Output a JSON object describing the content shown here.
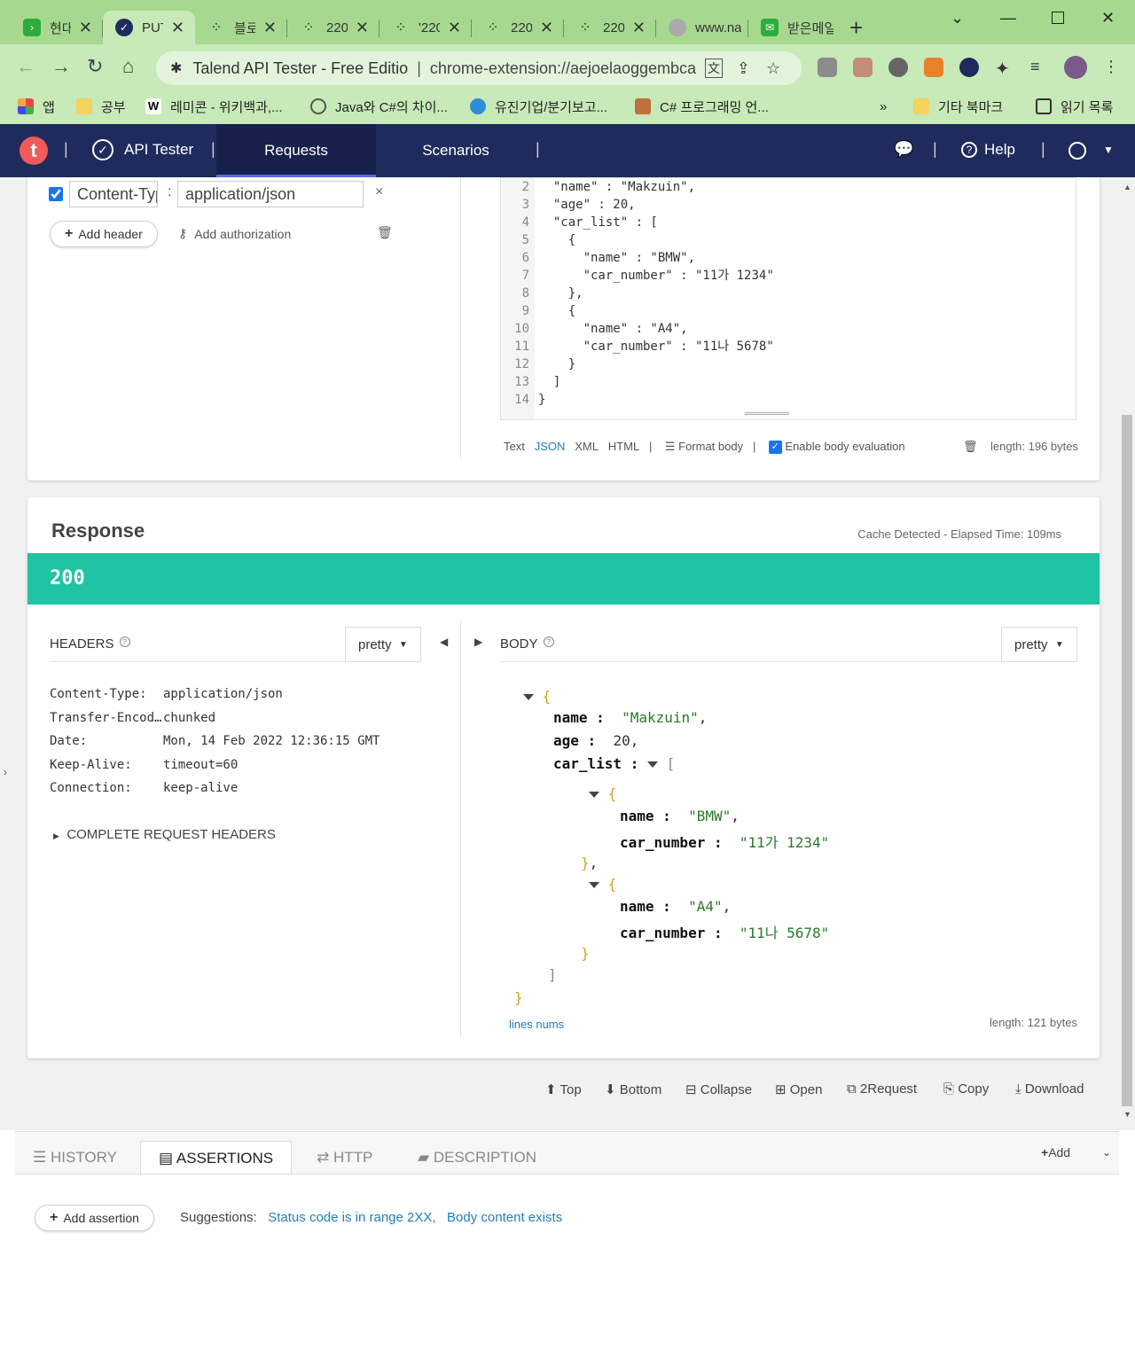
{
  "browser": {
    "tabs": [
      {
        "label": "현대",
        "color": "#2ead3b"
      },
      {
        "label": "PUT",
        "color": "#1f2b5c"
      },
      {
        "label": "블로",
        "color": "#333333"
      },
      {
        "label": "220",
        "color": "#333333"
      },
      {
        "label": "'220",
        "color": "#333333"
      },
      {
        "label": "220",
        "color": "#333333"
      },
      {
        "label": "220",
        "color": "#333333"
      },
      {
        "label": "www.na",
        "color": "#aaaaaa"
      },
      {
        "label": "받은메일",
        "color": "#2ead3b"
      }
    ],
    "omnibox": {
      "title": "Talend API Tester - Free Editio",
      "url": "chrome-extension://aejoelaoggembcahagimdiliamlcdmfm"
    },
    "bookmarks": [
      {
        "label": "앱"
      },
      {
        "label": "공부"
      },
      {
        "label": "레미콘 - 위키백과,..."
      },
      {
        "label": "Java와 C#의 차이..."
      },
      {
        "label": "유진기업/분기보고..."
      },
      {
        "label": "C# 프로그래밍 언..."
      }
    ],
    "bookmarks_more": "»",
    "other_bookmarks": "기타 북마크",
    "reading_list": "읽기 목록"
  },
  "app": {
    "logo": "t",
    "name": "API Tester",
    "nav": {
      "requests": "Requests",
      "scenarios": "Scenarios",
      "help": "Help"
    }
  },
  "request": {
    "header_name": "Content-Type",
    "header_value": "application/json",
    "remove": "×",
    "add_header": "Add header",
    "add_authorization": "Add authorization",
    "body_lines": [
      {
        "n": "2",
        "text": "  \"name\" : \"Makzuin\","
      },
      {
        "n": "3",
        "text": "  \"age\" : 20,"
      },
      {
        "n": "4",
        "text": "  \"car_list\" : ["
      },
      {
        "n": "5",
        "text": "    {"
      },
      {
        "n": "6",
        "text": "      \"name\" : \"BMW\","
      },
      {
        "n": "7",
        "text": "      \"car_number\" : \"11가 1234\""
      },
      {
        "n": "8",
        "text": "    },"
      },
      {
        "n": "9",
        "text": "    {"
      },
      {
        "n": "10",
        "text": "      \"name\" : \"A4\","
      },
      {
        "n": "11",
        "text": "      \"car_number\" : \"11나 5678\""
      },
      {
        "n": "12",
        "text": "    }"
      },
      {
        "n": "13",
        "text": "  ]"
      },
      {
        "n": "14",
        "text": "}"
      }
    ],
    "formats": {
      "text": "Text",
      "json": "JSON",
      "xml": "XML",
      "html": "HTML"
    },
    "format_body": "Format body",
    "enable_eval": "Enable body evaluation",
    "length": "length: 196 bytes"
  },
  "response": {
    "title": "Response",
    "cache": "Cache Detected - Elapsed Time: 109ms",
    "status": "200",
    "headers_label": "HEADERS",
    "body_label": "BODY",
    "pretty": "pretty",
    "headers": [
      {
        "k": "Content-Type:",
        "v": "application/json"
      },
      {
        "k": "Transfer-Encoding:",
        "v": "chunked"
      },
      {
        "k": "Date:",
        "v": "Mon, 14 Feb 2022 12:36:15 GMT"
      },
      {
        "k": "Keep-Alive:",
        "v": "timeout=60"
      },
      {
        "k": "Connection:",
        "v": "keep-alive"
      }
    ],
    "complete_headers": "COMPLETE REQUEST HEADERS",
    "body": {
      "name_key": "name :",
      "name_val": "\"Makzuin\"",
      "age_key": "age :",
      "age_val": "20",
      "carlist_key": "car_list :",
      "car1_name": "\"BMW\"",
      "car1_number": "\"11가 1234\"",
      "car2_name": "\"A4\"",
      "car2_number": "\"11나 5678\"",
      "car_name_key": "name :",
      "car_number_key": "car_number :"
    },
    "lines_nums": "lines nums",
    "length": "length: 121 bytes"
  },
  "actions": {
    "top": "Top",
    "bottom": "Bottom",
    "collapse": "Collapse",
    "open": "Open",
    "to_request": "2Request",
    "copy": "Copy",
    "download": "Download"
  },
  "bottom_panel": {
    "tabs": {
      "history": "HISTORY",
      "assertions": "ASSERTIONS",
      "http": "HTTP",
      "description": "DESCRIPTION"
    },
    "add": "Add",
    "add_assertion": "Add assertion",
    "suggestions_label": "Suggestions:",
    "suggestion1": "Status code is in range 2XX,",
    "suggestion2": "Body content exists"
  },
  "colors": {
    "accent": "#1fc4a4",
    "header_bg": "#1f2b5c",
    "link": "#1f80c0"
  }
}
